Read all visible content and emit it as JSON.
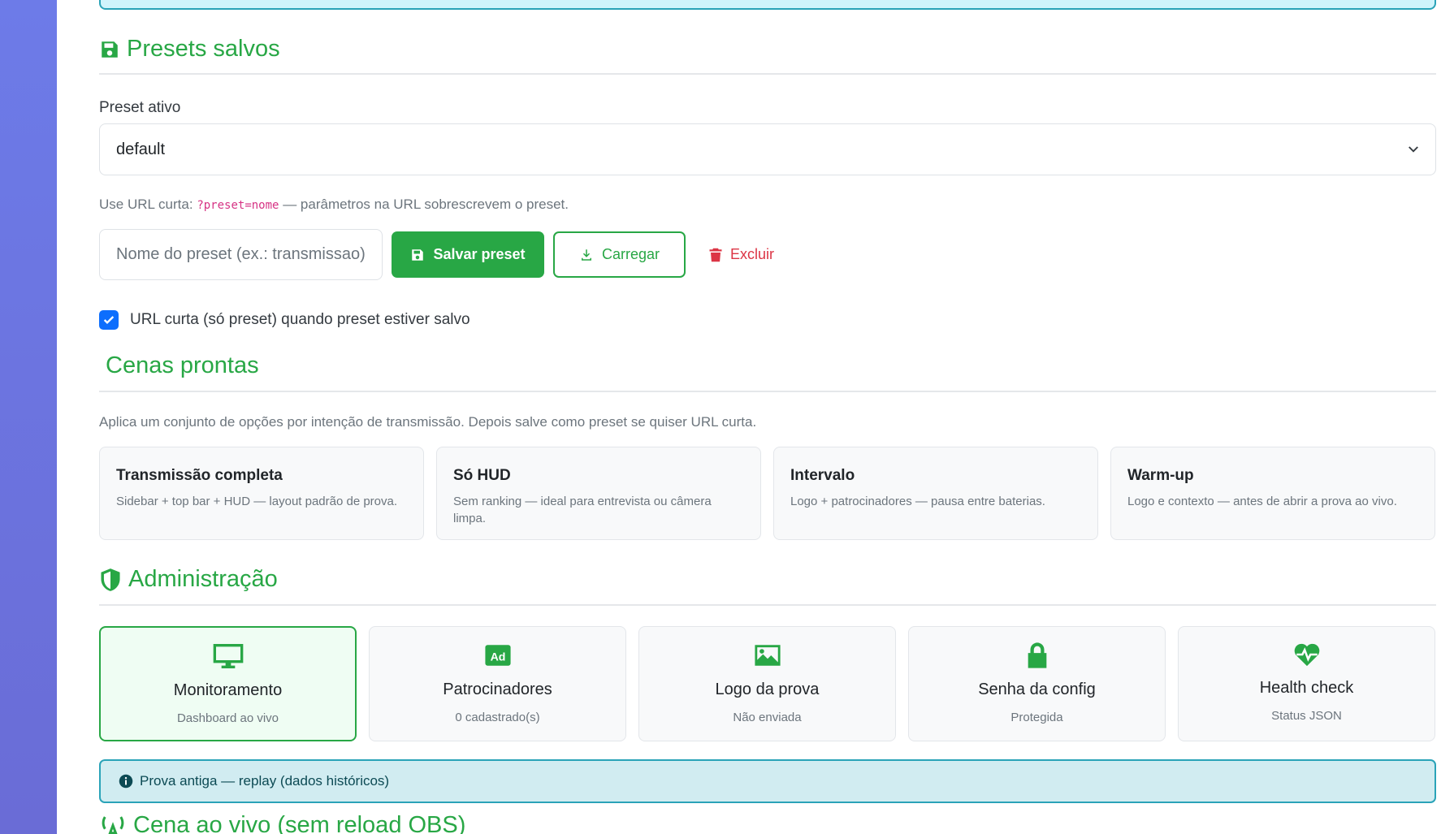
{
  "presets": {
    "title": "Presets salvos",
    "active_label": "Preset ativo",
    "selected": "default",
    "help_prefix": "Use URL curta:",
    "help_code": "?preset=nome",
    "help_suffix": "— parâmetros na URL sobrescrevem o preset.",
    "name_placeholder": "Nome do preset (ex.: transmissao)",
    "save_label": "Salvar preset",
    "load_label": "Carregar",
    "delete_label": "Excluir",
    "short_url_label": "URL curta (só preset) quando preset estiver salvo",
    "short_url_checked": true
  },
  "scenes": {
    "title": "Cenas prontas",
    "description": "Aplica um conjunto de opções por intenção de transmissão. Depois salve como preset se quiser URL curta.",
    "items": [
      {
        "title": "Transmissão completa",
        "desc": "Sidebar + top bar + HUD — layout padrão de prova."
      },
      {
        "title": "Só HUD",
        "desc": "Sem ranking — ideal para entrevista ou câmera limpa."
      },
      {
        "title": "Intervalo",
        "desc": "Logo + patrocinadores — pausa entre baterias."
      },
      {
        "title": "Warm-up",
        "desc": "Logo e contexto — antes de abrir a prova ao vivo."
      }
    ]
  },
  "admin": {
    "title": "Administração",
    "items": [
      {
        "icon": "monitor-icon",
        "title": "Monitoramento",
        "sub": "Dashboard ao vivo",
        "active": true
      },
      {
        "icon": "ad-icon",
        "title": "Patrocinadores",
        "sub": "0 cadastrado(s)"
      },
      {
        "icon": "image-icon",
        "title": "Logo da prova",
        "sub": "Não enviada"
      },
      {
        "icon": "lock-icon",
        "title": "Senha da config",
        "sub": "Protegida"
      },
      {
        "icon": "heartbeat-icon",
        "title": "Health check",
        "sub": "Status JSON"
      }
    ]
  },
  "info_alert": "Prova antiga — replay (dados históricos)",
  "live_scene": {
    "title": "Cena ao vivo (sem reload OBS)"
  },
  "colors": {
    "accent": "#28a745",
    "danger": "#dc3545",
    "info_border": "#2aa3b8",
    "checkbox": "#0d6efd"
  }
}
